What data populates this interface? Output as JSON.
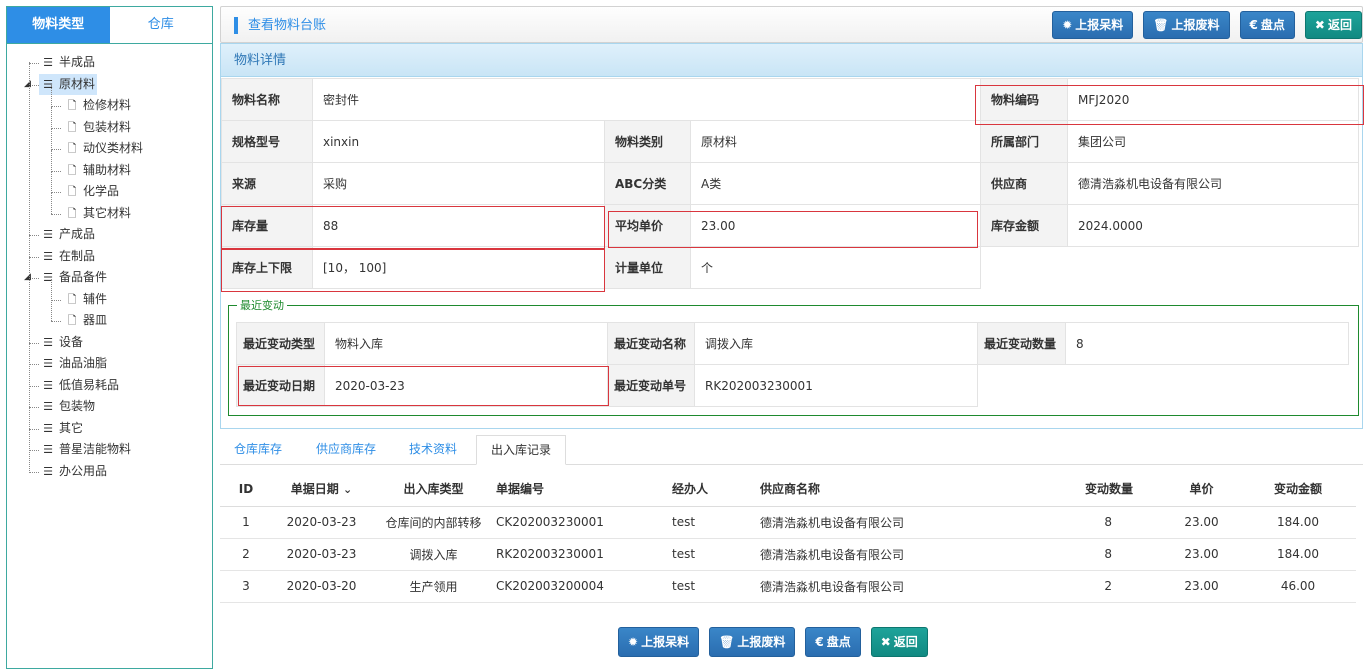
{
  "left": {
    "tabs": [
      "物料类型",
      "仓库"
    ],
    "tree": [
      {
        "label": "半成品"
      },
      {
        "label": "原材料",
        "children": [
          "检修材料",
          "包装材料",
          "动仪类材料",
          "辅助材料",
          "化学品",
          "其它材料"
        ]
      },
      {
        "label": "产成品"
      },
      {
        "label": "在制品"
      },
      {
        "label": "备品备件",
        "children": [
          "辅件",
          "器皿"
        ]
      },
      {
        "label": "设备"
      },
      {
        "label": "油品油脂"
      },
      {
        "label": "低值易耗品"
      },
      {
        "label": "包装物"
      },
      {
        "label": "其它"
      },
      {
        "label": "普星洁能物料"
      },
      {
        "label": "办公用品"
      }
    ]
  },
  "topbar": {
    "title": "查看物料台账",
    "buttons": {
      "report_idle": "上报呆料",
      "report_scrap": "上报废料",
      "inventory": "盘点",
      "back": "返回"
    }
  },
  "detail": {
    "header": "物料详情",
    "name_label": "物料名称",
    "name": "密封件",
    "code_label": "物料编码",
    "code": "MFJ2020",
    "spec_label": "规格型号",
    "spec": "xinxin",
    "category_label": "物料类别",
    "category": "原材料",
    "dept_label": "所属部门",
    "dept": "集团公司",
    "source_label": "来源",
    "source": "采购",
    "abc_label": "ABC分类",
    "abc": "A类",
    "supplier_label": "供应商",
    "supplier": "德清浩淼机电设备有限公司",
    "stock_label": "库存量",
    "stock": "88",
    "avg_price_label": "平均单价",
    "avg_price": "23.00",
    "amount_label": "库存金额",
    "amount": "2024.0000",
    "limits_label": "库存上下限",
    "limits": "[10， 100]",
    "unit_label": "计量单位",
    "unit": "个"
  },
  "recent": {
    "legend": "最近变动",
    "type_label": "最近变动类型",
    "type": "物料入库",
    "name_label": "最近变动名称",
    "name": "调拨入库",
    "qty_label": "最近变动数量",
    "qty": "8",
    "date_label": "最近变动日期",
    "date": "2020-03-23",
    "no_label": "最近变动单号",
    "no": "RK202003230001"
  },
  "bottom_tabs": [
    "仓库库存",
    "供应商库存",
    "技术资料",
    "出入库记录"
  ],
  "records": {
    "headers": [
      "ID",
      "单据日期",
      "出入库类型",
      "单据编号",
      "经办人",
      "供应商名称",
      "变动数量",
      "单价",
      "变动金额"
    ],
    "rows": [
      [
        "1",
        "2020-03-23",
        "仓库间的内部转移",
        "CK202003230001",
        "test",
        "德清浩淼机电设备有限公司",
        "8",
        "23.00",
        "184.00"
      ],
      [
        "2",
        "2020-03-23",
        "调拨入库",
        "RK202003230001",
        "test",
        "德清浩淼机电设备有限公司",
        "8",
        "23.00",
        "184.00"
      ],
      [
        "3",
        "2020-03-20",
        "生产领用",
        "CK202003200004",
        "test",
        "德清浩淼机电设备有限公司",
        "2",
        "23.00",
        "46.00"
      ]
    ]
  },
  "colors": {
    "primary": "#2e8ee6",
    "green_btn": "#118a82",
    "highlight": "#d9363e",
    "fieldset": "#1e8a2e"
  }
}
